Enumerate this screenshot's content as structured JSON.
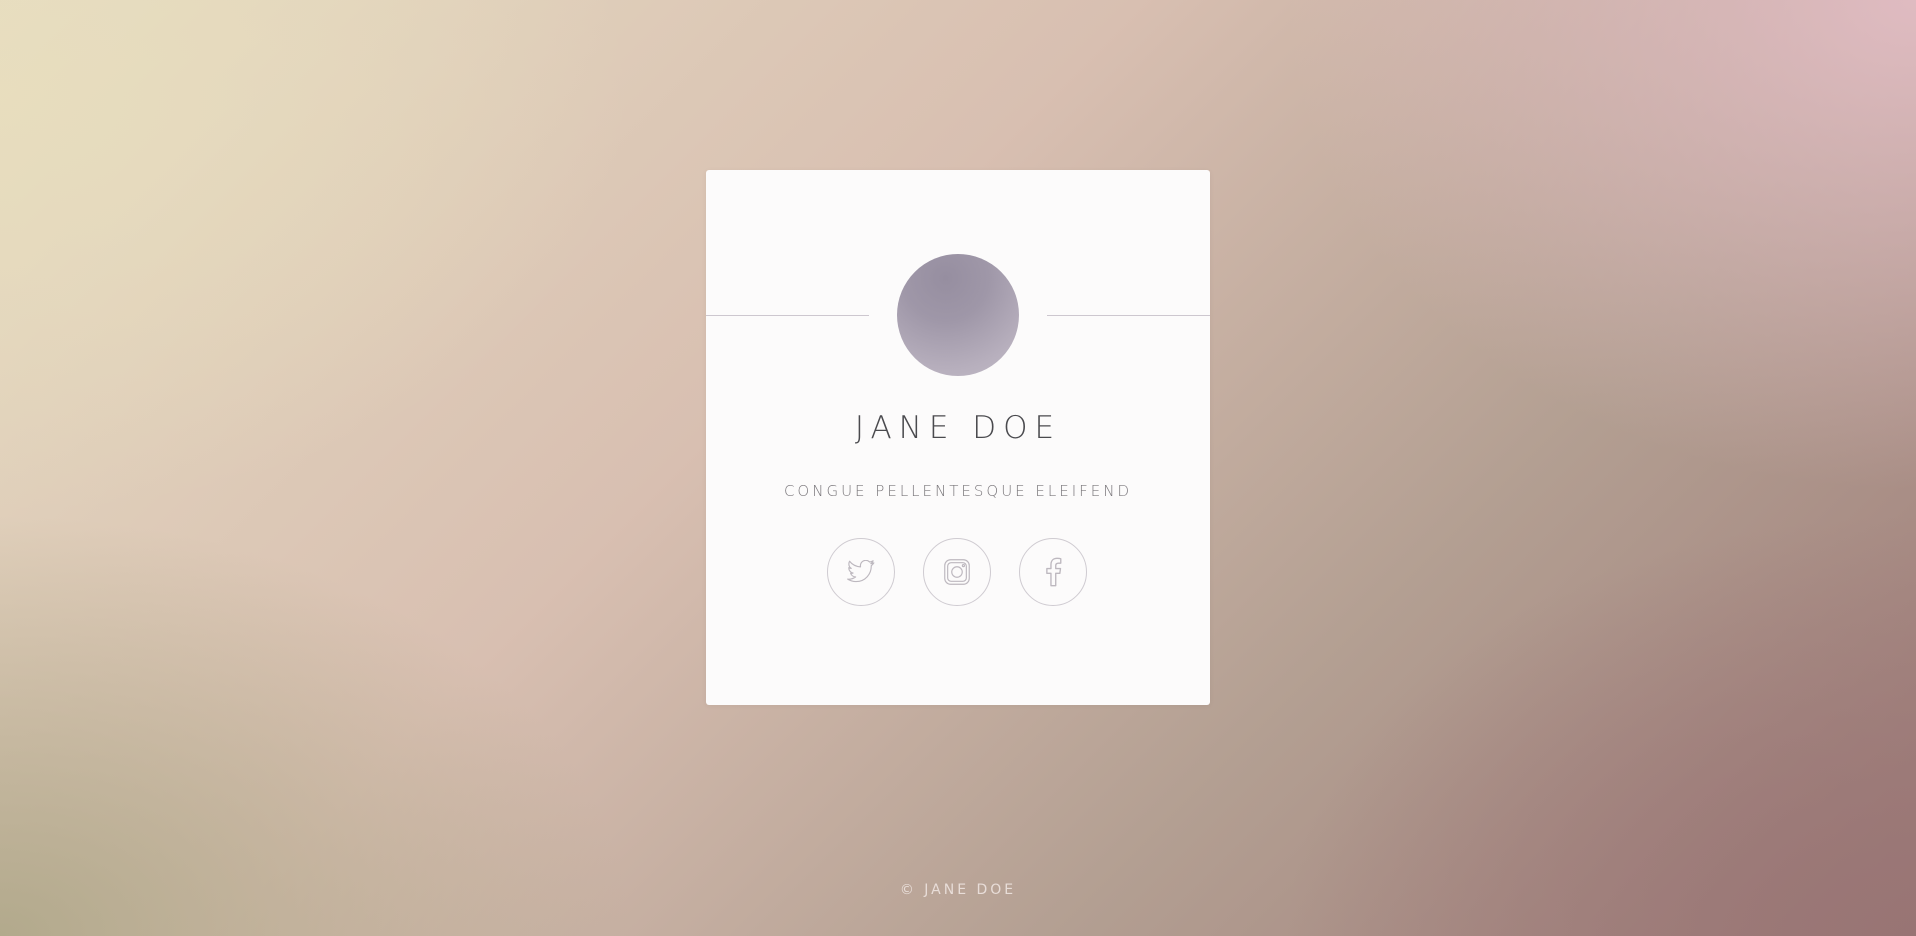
{
  "profile": {
    "name": "JANE DOE",
    "tagline": "CONGUE PELLENTESQUE ELEIFEND"
  },
  "social": [
    {
      "network": "twitter",
      "icon": "twitter-bird-icon"
    },
    {
      "network": "instagram",
      "icon": "instagram-camera-icon"
    },
    {
      "network": "facebook",
      "icon": "facebook-f-icon"
    }
  ],
  "footer": {
    "copyright": "© JANE DOE"
  },
  "colors": {
    "card_background": "#fcfbfb",
    "icon_stroke": "#bdb8bf",
    "name_text": "#4a4a4e"
  }
}
